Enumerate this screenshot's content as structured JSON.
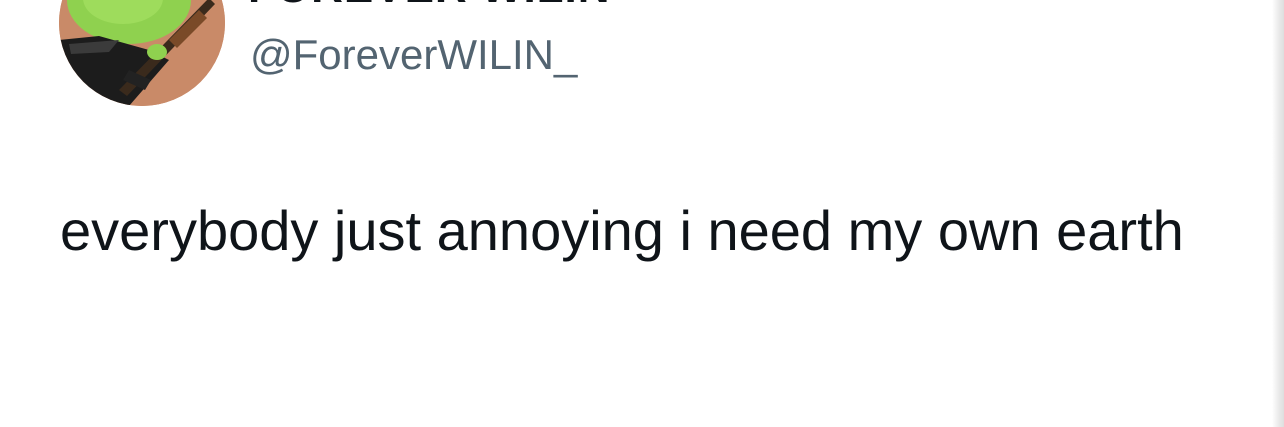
{
  "tweet": {
    "author": {
      "display_name": "FOREVER WILIN",
      "handle": "@ForeverWILIN_",
      "avatar_icon": "profile-avatar"
    },
    "text": "everybody just annoying i need my own earth"
  },
  "colors": {
    "background": "#ffffff",
    "text_primary": "#0f1419",
    "text_secondary": "#536471"
  }
}
